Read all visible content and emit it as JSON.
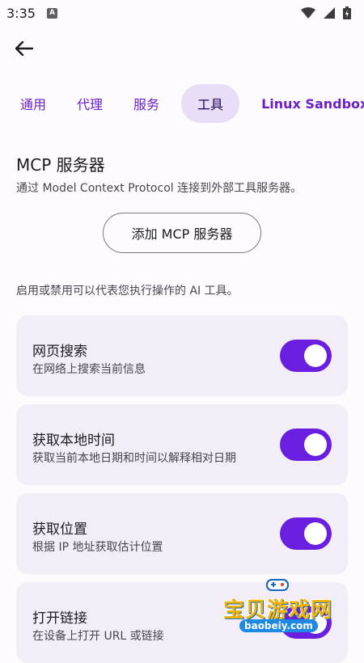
{
  "status_bar": {
    "time": "3:35",
    "badge": "A"
  },
  "tabs": [
    {
      "label": "通用"
    },
    {
      "label": "代理"
    },
    {
      "label": "服务"
    },
    {
      "label": "工具"
    },
    {
      "label": "Linux Sandbox"
    }
  ],
  "active_tab": "工具",
  "mcp": {
    "title": "MCP 服务器",
    "description": "通过 Model Context Protocol 连接到外部工具服务器。",
    "add_button": "添加 MCP 服务器"
  },
  "tools_hint": "启用或禁用可以代表您执行操作的 AI 工具。",
  "tools": [
    {
      "title": "网页搜索",
      "subtitle": "在网络上搜索当前信息",
      "enabled": true
    },
    {
      "title": "获取本地时间",
      "subtitle": "获取当前本地日期和时间以解释相对日期",
      "enabled": true
    },
    {
      "title": "获取位置",
      "subtitle": "根据 IP 地址获取估计位置",
      "enabled": true
    },
    {
      "title": "打开链接",
      "subtitle": "在设备上打开 URL 或链接",
      "enabled": true
    }
  ],
  "watermark": {
    "text": "宝贝游戏网",
    "url": "baobeiy.com"
  },
  "colors": {
    "accent": "#6a1fe0",
    "tab_text": "#6b1fc8",
    "active_tab_bg": "#e8def8",
    "card_bg": "#f2edf7"
  }
}
